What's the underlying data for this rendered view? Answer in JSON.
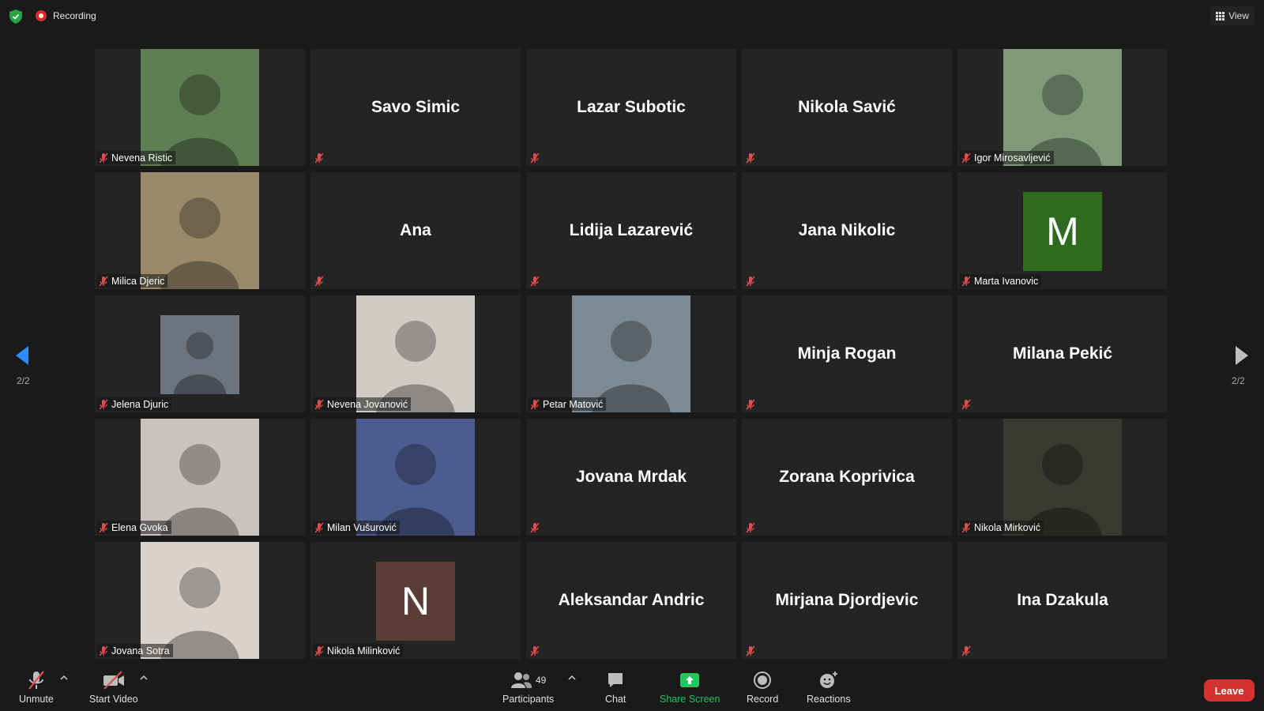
{
  "top_bar": {
    "recording_label": "Recording",
    "view_label": "View"
  },
  "pagination": {
    "left_page": "2/2",
    "right_page": "2/2"
  },
  "participants": [
    {
      "name": "Nevena Ristic",
      "muted": true,
      "video": "photo",
      "bg": "#5e7f53"
    },
    {
      "name": "Savo Simic",
      "muted": true,
      "video": "off"
    },
    {
      "name": "Lazar Subotic",
      "muted": true,
      "video": "off"
    },
    {
      "name": "Nikola Savić",
      "muted": true,
      "video": "off"
    },
    {
      "name": "Igor Mirosavljević",
      "muted": true,
      "video": "photo",
      "bg": "#7f9a78"
    },
    {
      "name": "Milica Djeric",
      "muted": true,
      "video": "photo",
      "bg": "#9a8a6a"
    },
    {
      "name": "Ana",
      "muted": true,
      "video": "off"
    },
    {
      "name": "Lidija Lazarević",
      "muted": true,
      "video": "off"
    },
    {
      "name": "Jana Nikolic",
      "muted": true,
      "video": "off"
    },
    {
      "name": "Marta Ivanovic",
      "muted": true,
      "video": "initial",
      "initial": "M",
      "initial_color": "#2e6b1f"
    },
    {
      "name": "Jelena Djuric",
      "muted": true,
      "video": "photo-small",
      "bg": "#6d7480"
    },
    {
      "name": "Nevena Jovanović",
      "muted": true,
      "video": "photo",
      "bg": "#cfcac4"
    },
    {
      "name": "Petar Matović",
      "muted": true,
      "video": "photo",
      "bg": "#7d8a94"
    },
    {
      "name": "Minja Rogan",
      "muted": true,
      "video": "off"
    },
    {
      "name": "Milana Pekić",
      "muted": true,
      "video": "off"
    },
    {
      "name": "Elena Gvoka",
      "muted": true,
      "video": "photo",
      "bg": "#c9c3c0"
    },
    {
      "name": "Milan Vušurović",
      "muted": true,
      "video": "photo",
      "bg": "#4c5c8e"
    },
    {
      "name": "Jovana Mrdak",
      "muted": true,
      "video": "off"
    },
    {
      "name": "Zorana Koprivica",
      "muted": true,
      "video": "off"
    },
    {
      "name": "Nikola Mirković",
      "muted": true,
      "video": "photo",
      "bg": "#3a3a32"
    },
    {
      "name": "Jovana Sotra",
      "muted": true,
      "video": "photo",
      "bg": "#d9d2cc"
    },
    {
      "name": "Nikola Milinković",
      "muted": true,
      "video": "initial",
      "initial": "N",
      "initial_color": "#5a3e36"
    },
    {
      "name": "Aleksandar Andric",
      "muted": true,
      "video": "off"
    },
    {
      "name": "Mirjana Djordjevic",
      "muted": true,
      "video": "off"
    },
    {
      "name": "Ina Dzakula",
      "muted": true,
      "video": "off"
    }
  ],
  "toolbar": {
    "unmute_label": "Unmute",
    "start_video_label": "Start Video",
    "participants_label": "Participants",
    "participants_count": "49",
    "chat_label": "Chat",
    "share_screen_label": "Share Screen",
    "record_label": "Record",
    "reactions_label": "Reactions",
    "leave_label": "Leave"
  },
  "colors": {
    "background": "#1a1a1a",
    "tile": "#242424",
    "share_green": "#22c55e",
    "leave_red": "#d63131",
    "mute_red": "#e34c4c",
    "arrow_blue": "#2d8cff"
  }
}
